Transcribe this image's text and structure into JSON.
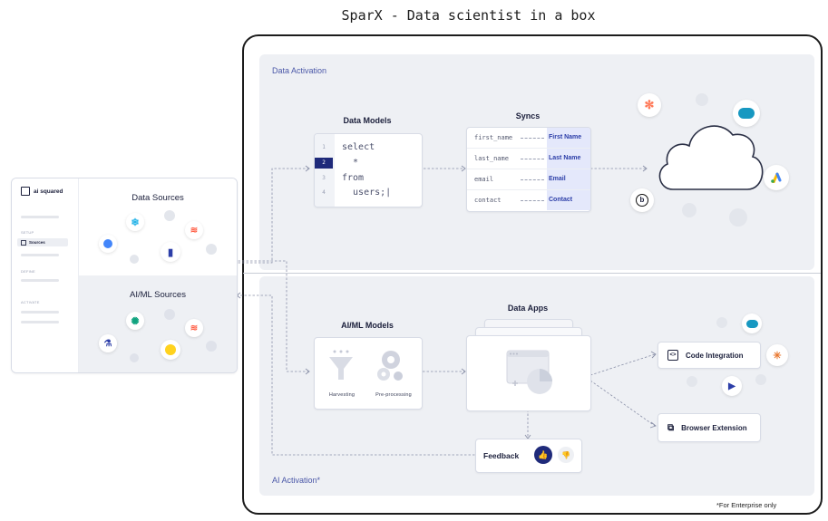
{
  "title": "SparX - Data scientist in a box",
  "footnote": "*For Enterprise only",
  "data_activation": {
    "label": "Data Activation",
    "models": {
      "heading": "Data Models",
      "lines": [
        {
          "n": "1",
          "code": "select"
        },
        {
          "n": "2",
          "code": "  *"
        },
        {
          "n": "3",
          "code": "from"
        },
        {
          "n": "4",
          "code": "  users;|"
        }
      ]
    },
    "syncs": {
      "heading": "Syncs",
      "rows": [
        {
          "left": "first_name",
          "right": "First Name"
        },
        {
          "left": "last_name",
          "right": "Last Name"
        },
        {
          "left": "email",
          "right": "Email"
        },
        {
          "left": "contact",
          "right": "Contact"
        }
      ]
    }
  },
  "ai_activation": {
    "label": "AI Activation*",
    "models": {
      "heading": "AI/ML Models",
      "harvesting": "Harvesting",
      "preprocessing": "Pre-processing"
    },
    "apps": {
      "heading": "Data Apps"
    },
    "code_integration": "Code Integration",
    "browser_extension": "Browser Extension",
    "feedback": "Feedback"
  },
  "left_panel": {
    "brand": "ai squared",
    "data_sources": "Data Sources",
    "aiml_sources": "AI/ML Sources",
    "nav": {
      "setup": "SETUP",
      "sources": "Sources",
      "define": "DEFINE",
      "activate": "ACTIVATE"
    }
  },
  "colors": {
    "accent": "#2c3ea8",
    "panel": "#eef0f4",
    "navy": "#1f2a7a"
  },
  "icons": {
    "hubspot": "hubspot-icon",
    "salesforce": "salesforce-icon",
    "google_ads": "google-ads-icon",
    "braze": "braze-icon",
    "snowflake": "snowflake-icon",
    "databricks": "databricks-icon",
    "bigquery": "bigquery-icon",
    "openai": "openai-icon",
    "huggingface": "huggingface-icon"
  }
}
